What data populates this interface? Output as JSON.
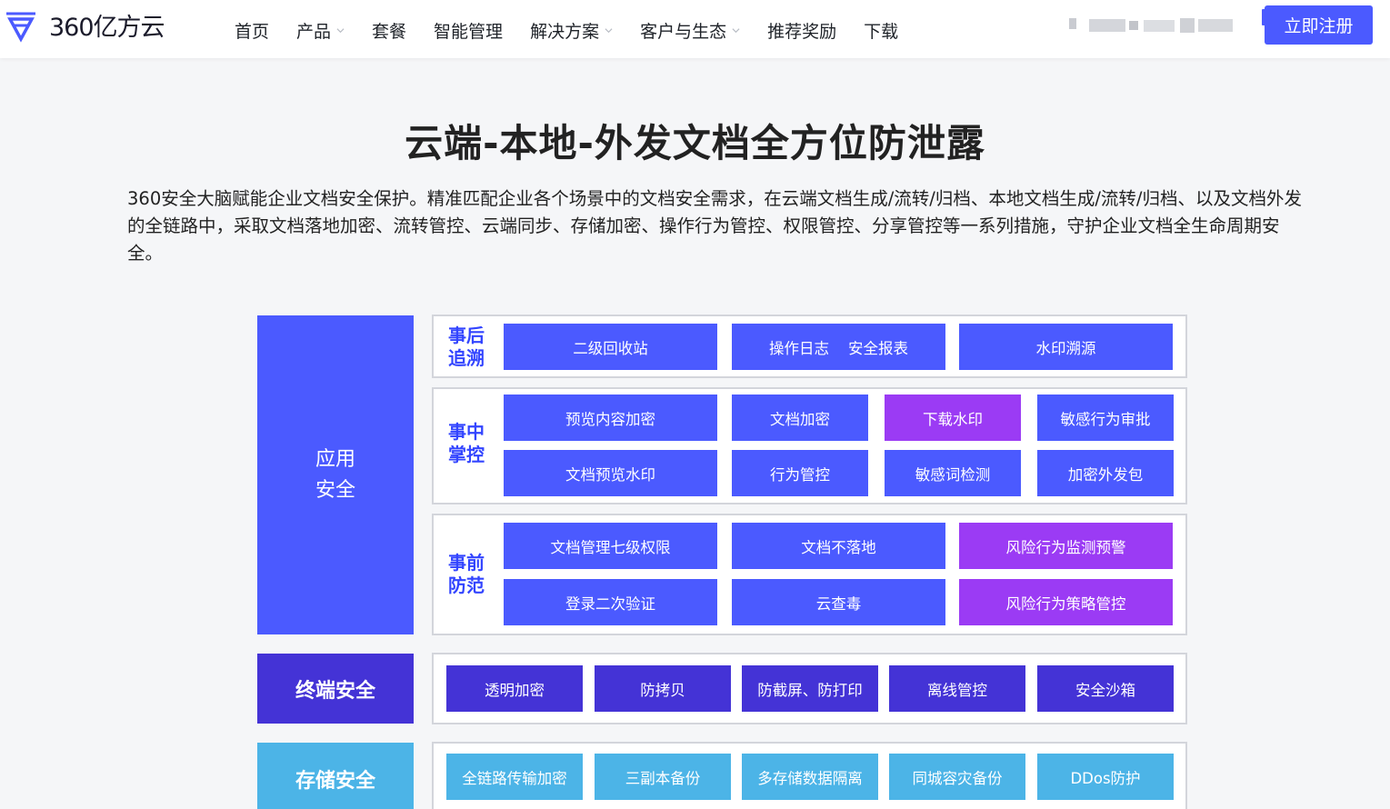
{
  "brand": {
    "name": "360亿方云"
  },
  "nav": {
    "items": [
      {
        "label": "首页"
      },
      {
        "label": "产品"
      },
      {
        "label": "套餐"
      },
      {
        "label": "智能管理"
      },
      {
        "label": "解决方案"
      },
      {
        "label": "客户与生态"
      },
      {
        "label": "推荐奖励"
      },
      {
        "label": "下载"
      }
    ],
    "register_label": "立即注册"
  },
  "main": {
    "title": "云端-本地-外发文档全方位防泄露",
    "description": "360安全大脑赋能企业文档安全保护。精准匹配企业各个场景中的文档安全需求，在云端文档生成/流转/归档、本地文档生成/流转/归档、以及文档外发的全链路中，采取文档落地加密、流转管控、云端同步、存储加密、操作行为管控、权限管控、分享管控等一系列措施，守护企业文档全生命周期安全。"
  },
  "diagram": {
    "app_security": {
      "line1": "应用",
      "line2": "安全"
    },
    "terminal_security": {
      "label": "终端安全"
    },
    "storage_security": {
      "label": "存储安全"
    },
    "post": {
      "line1": "事后",
      "line2": "追溯",
      "items": [
        "二级回收站",
        "操作日志    安全报表",
        "水印溯源"
      ]
    },
    "during": {
      "line1": "事中",
      "line2": "掌控",
      "items": [
        "预览内容加密",
        "文档加密",
        "下载水印",
        "敏感行为审批",
        "文档预览水印",
        "行为管控",
        "敏感词检测",
        "加密外发包"
      ]
    },
    "pre": {
      "line1": "事前",
      "line2": "防范",
      "items": [
        "文档管理七级权限",
        "文档不落地",
        "风险行为监测预警",
        "登录二次验证",
        "云查毒",
        "风险行为策略管控"
      ]
    },
    "terminal_items": [
      "透明加密",
      "防拷贝",
      "防截屏、防打印",
      "离线管控",
      "安全沙箱"
    ],
    "storage_items": [
      "全链路传输加密",
      "三副本备份",
      "多存储数据隔离",
      "同城容灾备份",
      "DDos防护"
    ]
  },
  "colors": {
    "primary": "#4b5aff",
    "purple": "#9b3bf4",
    "indigo": "#4433d6",
    "sky": "#4cb4e7",
    "label_blue": "#3345ff"
  }
}
